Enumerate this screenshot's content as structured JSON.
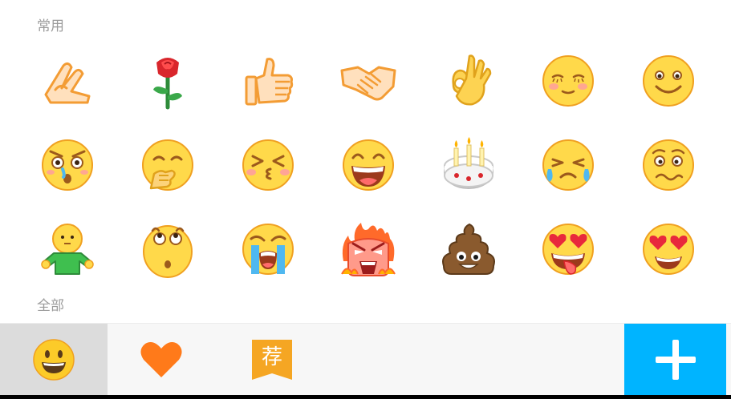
{
  "sections": {
    "common_label": "常用",
    "all_label": "全部"
  },
  "emojis": [
    {
      "name": "pray-hands-icon"
    },
    {
      "name": "rose-icon"
    },
    {
      "name": "thumbs-up-icon"
    },
    {
      "name": "handshake-icon"
    },
    {
      "name": "ok-hand-icon"
    },
    {
      "name": "shy-face-icon"
    },
    {
      "name": "smile-face-icon"
    },
    {
      "name": "shocked-face-icon"
    },
    {
      "name": "covering-mouth-face-icon"
    },
    {
      "name": "kiss-face-icon"
    },
    {
      "name": "grinning-face-icon"
    },
    {
      "name": "birthday-cake-icon"
    },
    {
      "name": "tears-face-icon"
    },
    {
      "name": "worried-face-icon"
    },
    {
      "name": "green-shirt-person-icon"
    },
    {
      "name": "rolling-eyes-face-icon"
    },
    {
      "name": "crying-face-icon"
    },
    {
      "name": "furious-face-icon"
    },
    {
      "name": "poop-icon"
    },
    {
      "name": "heart-eyes-tongue-face-icon"
    },
    {
      "name": "heart-eyes-face-icon"
    }
  ],
  "toolbar": {
    "recommended_badge": "荐",
    "colors": {
      "accent": "#00b4ff",
      "heart": "#ff7a1a",
      "badge": "#f5a623",
      "selected_tab": "#dcdcdc"
    }
  }
}
